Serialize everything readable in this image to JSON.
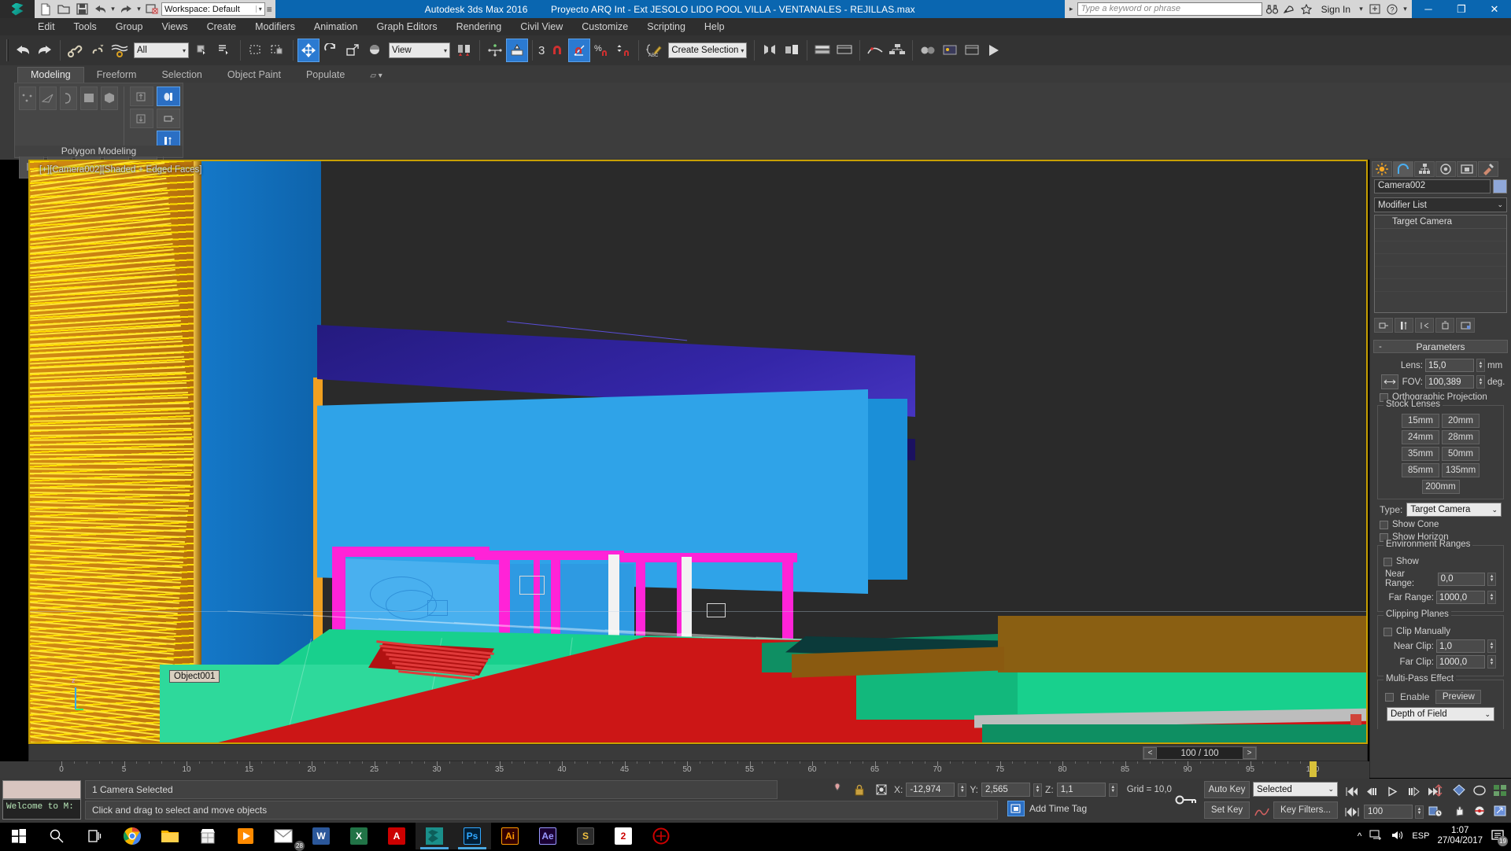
{
  "titlebar": {
    "logo": "max-logo-icon",
    "workspace_label": "Workspace: Default",
    "app_name": "Autodesk 3ds Max 2016",
    "document_title": "Proyecto ARQ Int - Ext JESOLO LIDO POOL VILLA - VENTANALES - REJILLAS.max",
    "search_placeholder": "Type a keyword or phrase",
    "signin_label": "Sign In",
    "quick_access": [
      "new-file-icon",
      "open-file-icon",
      "save-file-icon",
      "undo-icon",
      "undo-dropdown-icon",
      "redo-icon",
      "redo-dropdown-icon",
      "project-folder-icon"
    ],
    "window_buttons": [
      "minimize-icon",
      "restore-icon",
      "close-icon"
    ]
  },
  "menubar": {
    "items": [
      "Edit",
      "Tools",
      "Group",
      "Views",
      "Create",
      "Modifiers",
      "Animation",
      "Graph Editors",
      "Rendering",
      "Civil View",
      "Customize",
      "Scripting",
      "Help"
    ]
  },
  "toolbar": {
    "selection_filter": "All",
    "ref_coord_system": "View",
    "named_selection_set": "Create Selection Se",
    "angle_snap_value": "3",
    "icons": [
      "undo-icon",
      "redo-icon",
      "select-link-icon",
      "unlink-icon",
      "bind-space-warp-icon",
      "select-object-icon",
      "select-by-name-icon",
      "rectangle-select-region-icon",
      "window-crossing-icon",
      "select-and-move-icon",
      "select-and-rotate-icon",
      "select-and-scale-icon",
      "select-and-place-icon",
      "use-center-flyout-icon",
      "mirror-icon",
      "align-icon",
      "snaps-toggle-icon",
      "angle-snap-icon",
      "percent-snap-icon",
      "spinner-snap-icon",
      "edit-named-selection-icon",
      "mirror-tool-icon",
      "layer-manager-icon",
      "curve-editor-icon",
      "schematic-view-icon",
      "material-editor-icon",
      "render-setup-icon",
      "render-frame-window-icon",
      "render-production-icon"
    ]
  },
  "ribbon": {
    "tabs": [
      "Modeling",
      "Freeform",
      "Selection",
      "Object Paint",
      "Populate"
    ],
    "active_tab": "Modeling",
    "panel_title": "Polygon Modeling",
    "panel_icons": [
      "vertex-icon",
      "edge-icon",
      "border-icon",
      "polygon-icon",
      "element-icon",
      "generate-topology-icon",
      "symmetry-icon",
      "paint-deform-icon",
      "repeat-last-icon",
      "swift-loop-icon",
      "use-stack-selection-icon",
      "pin-stack-icon",
      "show-end-result-icon",
      "toggle-ribbon-icon"
    ]
  },
  "viewport": {
    "label": "[+][Camera002][Shaded + Edged Faces]",
    "object_tooltip": "Object001",
    "gizmo_axis": "z",
    "time_display": "100 / 100",
    "prev_label": "<",
    "next_label": ">",
    "ruler_ticks": [
      "0",
      "5",
      "10",
      "15",
      "20",
      "25",
      "30",
      "35",
      "40",
      "45",
      "50",
      "55",
      "60",
      "65",
      "70",
      "75",
      "80",
      "85",
      "90",
      "95",
      "100"
    ]
  },
  "command_panel": {
    "tabs": [
      "create-tab-icon",
      "modify-tab-icon",
      "hierarchy-tab-icon",
      "motion-tab-icon",
      "display-tab-icon",
      "utilities-tab-icon"
    ],
    "active_tab_index": 1,
    "object_name": "Camera002",
    "object_color": "#8fa7d8",
    "modifier_list_label": "Modifier List",
    "stack_items": [
      "Target Camera"
    ],
    "stack_buttons": [
      "pin-stack-icon",
      "show-end-result-icon",
      "make-unique-icon",
      "remove-modifier-icon",
      "configure-modifier-sets-icon"
    ],
    "parameters": {
      "title": "Parameters",
      "collapse_glyph": "-",
      "lens_label": "Lens:",
      "lens_value": "15,0",
      "lens_unit": "mm",
      "fov_label": "FOV:",
      "fov_value": "100,389",
      "fov_unit": "deg.",
      "fov_direction_icon": "horizontal-fov-icon",
      "orthographic_label": "Orthographic Projection",
      "orthographic_checked": false,
      "stock_lenses_label": "Stock Lenses",
      "stock_lenses": [
        "15mm",
        "20mm",
        "24mm",
        "28mm",
        "35mm",
        "50mm",
        "85mm",
        "135mm",
        "200mm"
      ],
      "type_label": "Type:",
      "type_value": "Target Camera",
      "show_cone_label": "Show Cone",
      "show_cone_checked": false,
      "show_horizon_label": "Show Horizon",
      "show_horizon_checked": false,
      "env_ranges_label": "Environment Ranges",
      "env_show_label": "Show",
      "env_show_checked": false,
      "near_range_label": "Near Range:",
      "near_range_value": "0,0",
      "far_range_label": "Far Range:",
      "far_range_value": "1000,0",
      "clipping_label": "Clipping Planes",
      "clip_manually_label": "Clip Manually",
      "clip_manually_checked": false,
      "near_clip_label": "Near Clip:",
      "near_clip_value": "1,0",
      "far_clip_label": "Far Clip:",
      "far_clip_value": "1000,0",
      "multipass_label": "Multi-Pass Effect",
      "enable_label": "Enable",
      "enable_checked": false,
      "preview_label": "Preview",
      "effect_value": "Depth of Field"
    }
  },
  "statusbar": {
    "listener_text": "Welcome to M:",
    "selection_status": "1 Camera Selected",
    "prompt": "Click and drag to select and move objects",
    "x_label": "X:",
    "x_value": "-12,974",
    "y_label": "Y:",
    "y_value": "2,565",
    "z_label": "Z:",
    "z_value": "1,1",
    "grid_label": "Grid = 10,0",
    "add_time_tag": "Add Time Tag",
    "lock_icon": "selection-lock-icon",
    "isolate_icon": "isolate-selection-icon",
    "absolute_mode_icon": "absolute-relative-transform-icon"
  },
  "animation": {
    "auto_key_label": "Auto Key",
    "set_key_label": "Set Key",
    "key_mode_value": "Selected",
    "key_filters_label": "Key Filters...",
    "current_frame": "100",
    "playback_icons": [
      "go-to-start-icon",
      "previous-frame-icon",
      "play-animation-icon",
      "next-frame-icon",
      "go-to-end-icon"
    ],
    "nav_icons": [
      "zoom-icon",
      "zoom-all-icon",
      "zoom-extents-icon",
      "zoom-region-icon",
      "pan-view-icon",
      "orbit-icon",
      "maximize-viewport-icon"
    ],
    "key_toggle_icon": "key-mode-toggle-icon",
    "set_key_curve_icon": "set-key-curve-icon",
    "time_config_icon": "time-configuration-icon"
  },
  "taskbar": {
    "start_icon": "windows-start-icon",
    "search_icon": "search-icon",
    "taskview_icon": "task-view-icon",
    "apps": [
      {
        "name": "chrome-icon",
        "label": ""
      },
      {
        "name": "file-explorer-icon",
        "label": ""
      },
      {
        "name": "store-icon",
        "label": ""
      },
      {
        "name": "media-player-icon",
        "label": ""
      },
      {
        "name": "mail-icon",
        "label": "28"
      },
      {
        "name": "word-icon",
        "label": "W"
      },
      {
        "name": "excel-icon",
        "label": "X"
      },
      {
        "name": "acrobat-icon",
        "label": "A"
      },
      {
        "name": "3dsmax-icon",
        "label": ""
      },
      {
        "name": "photoshop-icon",
        "label": "Ps"
      },
      {
        "name": "illustrator-icon",
        "label": "Ai"
      },
      {
        "name": "aftereffects-icon",
        "label": "Ae"
      },
      {
        "name": "sublime-icon",
        "label": "S"
      },
      {
        "name": "powerpoint-icon",
        "label": "2"
      },
      {
        "name": "teamviewer-icon",
        "label": ""
      }
    ],
    "tray": {
      "chevron_icon": "show-hidden-icons-icon",
      "network_icon": "network-icon",
      "volume_icon": "volume-icon",
      "language": "ESP",
      "time": "1:07",
      "date": "27/04/2017",
      "notification_count": "19"
    }
  }
}
